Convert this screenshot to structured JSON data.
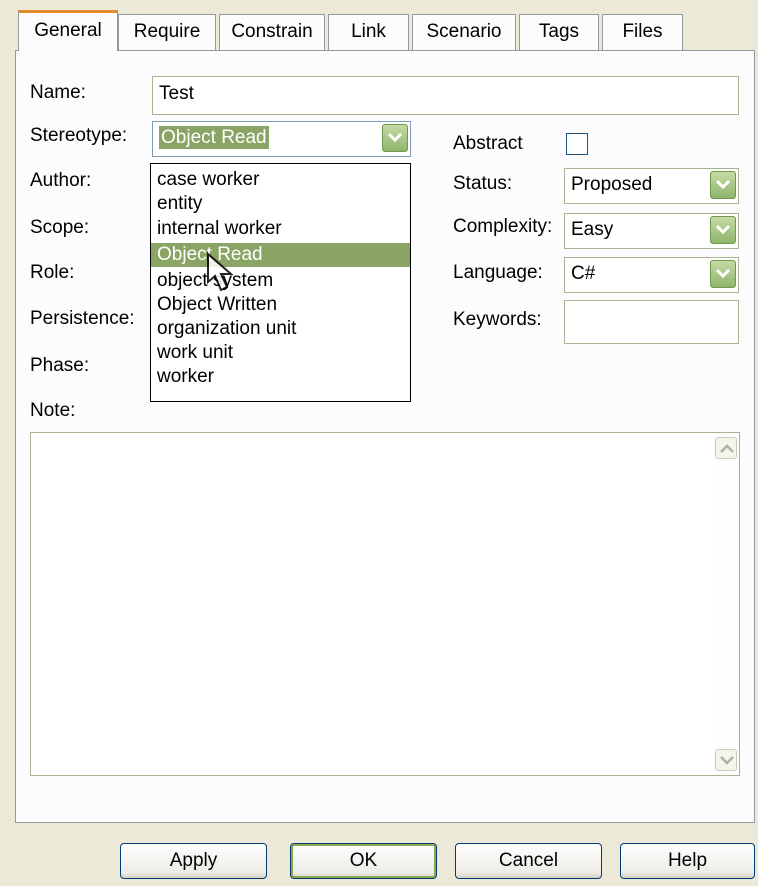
{
  "tabs": [
    "General",
    "Require",
    "Constrain",
    "Link",
    "Scenario",
    "Tags",
    "Files"
  ],
  "labels": {
    "name": "Name:",
    "stereotype": "Stereotype:",
    "author": "Author:",
    "scope": "Scope:",
    "role": "Role:",
    "persistence": "Persistence:",
    "phase": "Phase:",
    "note": "Note:",
    "abstract": "Abstract",
    "status": "Status:",
    "complexity": "Complexity:",
    "language": "Language:",
    "keywords": "Keywords:"
  },
  "values": {
    "name": "Test",
    "stereotype": "Object Read",
    "status": "Proposed",
    "complexity": "Easy",
    "language": "C#",
    "keywords": "",
    "abstract_checked": false
  },
  "stereotype_options": [
    "case worker",
    "entity",
    "internal worker",
    "Object Read",
    "object system",
    "Object Written",
    "organization unit",
    "work unit",
    "worker"
  ],
  "selected_option_index": 3,
  "buttons": {
    "apply": "Apply",
    "ok": "OK",
    "cancel": "Cancel",
    "help": "Help"
  },
  "colors": {
    "accent_tab": "#e68b2c",
    "selection": "#8aa466",
    "dropdown_button": "#8fb56b",
    "dialog_bg": "#ece9d8"
  }
}
